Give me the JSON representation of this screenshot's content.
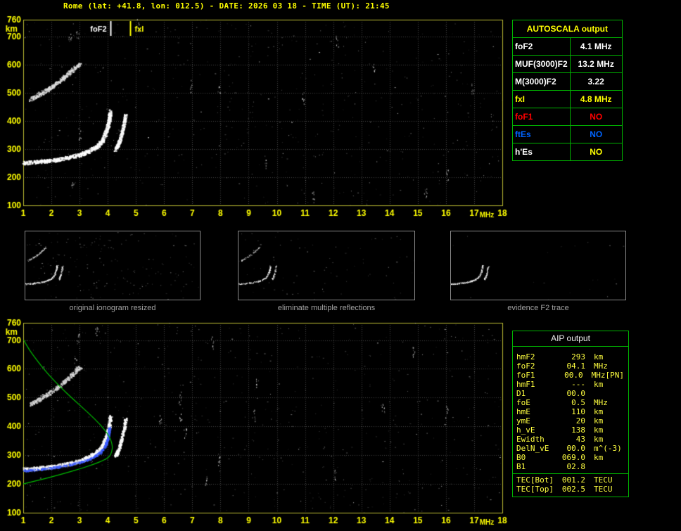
{
  "title": "Rome (lat: +41.8, lon: 012.5) - DATE: 2026 03 18 - TIME (UT): 21:45",
  "colors": {
    "accent_yellow": "#ffff00",
    "table_green": "#00b400",
    "profile_green": "#00bb00",
    "trace_white": "#ffffff",
    "restored_blue": "#3c5cff",
    "no_red": "#ff0000",
    "no_blue": "#0064ff",
    "caption_gray": "#a2a2a2"
  },
  "autoscala_table": {
    "header": "AUTOSCALA output",
    "header_color": "#ffff00",
    "rows": [
      {
        "label": "foF2",
        "value": "4.1 MHz",
        "label_color": "#ffffff",
        "value_color": "#ffffff"
      },
      {
        "label": "MUF(3000)F2",
        "value": "13.2 MHz",
        "label_color": "#ffffff",
        "value_color": "#ffffff"
      },
      {
        "label": "M(3000)F2",
        "value": "3.22",
        "label_color": "#ffffff",
        "value_color": "#ffffff"
      },
      {
        "label": "fxI",
        "value": "4.8 MHz",
        "label_color": "#ffff00",
        "value_color": "#ffff00"
      },
      {
        "label": "foF1",
        "value": "NO",
        "label_color": "#ff0000",
        "value_color": "#ff0000"
      },
      {
        "label": "ftEs",
        "value": "NO",
        "label_color": "#0064ff",
        "value_color": "#0064ff"
      },
      {
        "label": "h'Es",
        "value": "NO",
        "label_color": "#ffffff",
        "value_color": "#ffff00"
      }
    ]
  },
  "thumbnails": [
    {
      "caption": "original ionogram resized",
      "noise": 170,
      "trace_indices": [
        0,
        1,
        2
      ],
      "density_scale": 0.3
    },
    {
      "caption": "eliminate multiple reflections",
      "noise": 75,
      "trace_indices": [
        0,
        1,
        2
      ],
      "density_scale": 0.22
    },
    {
      "caption": "evidence F2 trace",
      "noise": 20,
      "trace_indices": [
        0,
        1
      ],
      "density_scale": 0.28
    }
  ],
  "aip_table": {
    "header": "AIP output",
    "rows": [
      {
        "label": "hmF2",
        "value": "293",
        "unit": "km",
        "extra": ""
      },
      {
        "label": "foF2",
        "value": "04.1",
        "unit": "MHz",
        "extra": ""
      },
      {
        "label": "foF1",
        "value": "00.0",
        "unit": "MHz",
        "extra": "[PN]"
      },
      {
        "label": "hmF1",
        "value": "---",
        "unit": "km",
        "extra": ""
      },
      {
        "label": "D1",
        "value": "00.0",
        "unit": "",
        "extra": ""
      },
      {
        "label": "foE",
        "value": "0.5",
        "unit": "MHz",
        "extra": ""
      },
      {
        "label": "hmE",
        "value": "110",
        "unit": "km",
        "extra": ""
      },
      {
        "label": "ymE",
        "value": "20",
        "unit": "km",
        "extra": ""
      },
      {
        "label": "h_vE",
        "value": "138",
        "unit": "km",
        "extra": ""
      },
      {
        "label": "Ewidth",
        "value": "43",
        "unit": "km",
        "extra": ""
      },
      {
        "label": "DelN_vE",
        "value": "00.0",
        "unit": "m^(-3)",
        "extra": ""
      },
      {
        "label": "B0",
        "value": "069.0",
        "unit": "km",
        "extra": ""
      },
      {
        "label": "B1",
        "value": "02.8",
        "unit": "",
        "extra": ""
      }
    ],
    "tec_rows": [
      {
        "label": "TEC[Bot]",
        "value": "001.2",
        "unit": "TECU"
      },
      {
        "label": "TEC[Top]",
        "value": "002.5",
        "unit": "TECU"
      }
    ]
  },
  "chart_data": [
    {
      "id": "main-ionogram",
      "type": "scatter",
      "title": "recorded ionogram",
      "xlabel": "MHz",
      "ylabel": "km",
      "xlim": [
        1,
        18
      ],
      "ylim": [
        100,
        760
      ],
      "x_ticks": [
        1,
        2,
        3,
        4,
        5,
        6,
        7,
        8,
        9,
        10,
        11,
        12,
        13,
        14,
        15,
        16,
        17,
        18
      ],
      "y_ticks": [
        760,
        700,
        600,
        500,
        400,
        300,
        200,
        100
      ],
      "tick_color": "#ffff00",
      "border_color": "#b8b832",
      "grid": true,
      "legend": "none",
      "noise_points": 520,
      "markers": [
        {
          "label": "foF2",
          "x": 4.1,
          "color": "#ffffff",
          "label_side": "left"
        },
        {
          "label": "fxI",
          "x": 4.8,
          "color": "#ffff00",
          "label_side": "right"
        }
      ],
      "traces": [
        {
          "name": "F2-ordinary-trace",
          "color": "#ffffff",
          "density": 900,
          "spread": 5,
          "points": [
            [
              1.0,
              252
            ],
            [
              1.4,
              255
            ],
            [
              1.8,
              259
            ],
            [
              2.2,
              264
            ],
            [
              2.6,
              271
            ],
            [
              3.0,
              281
            ],
            [
              3.3,
              293
            ],
            [
              3.6,
              310
            ],
            [
              3.8,
              333
            ],
            [
              3.95,
              368
            ],
            [
              4.03,
              400
            ],
            [
              4.08,
              436
            ]
          ]
        },
        {
          "name": "F2-extraordinary-trace",
          "color": "#ffffff",
          "density": 280,
          "spread": 4,
          "points": [
            [
              4.25,
              298
            ],
            [
              4.35,
              316
            ],
            [
              4.45,
              344
            ],
            [
              4.55,
              384
            ],
            [
              4.62,
              428
            ]
          ]
        },
        {
          "name": "second-hop-trace",
          "color": "#e0e0e0",
          "density": 340,
          "spread": 5,
          "points": [
            [
              1.25,
              478
            ],
            [
              1.55,
              496
            ],
            [
              1.85,
              513
            ],
            [
              2.15,
              533
            ],
            [
              2.45,
              557
            ],
            [
              2.75,
              583
            ],
            [
              3.0,
              608
            ]
          ]
        }
      ]
    },
    {
      "id": "profile-ionogram",
      "type": "scatter",
      "title": "ionogram with restored trace and electron density profile",
      "xlabel": "MHz",
      "ylabel": "km",
      "xlim": [
        1,
        18
      ],
      "ylim": [
        100,
        760
      ],
      "x_ticks": [
        1,
        2,
        3,
        4,
        5,
        6,
        7,
        8,
        9,
        10,
        11,
        12,
        13,
        14,
        15,
        16,
        17,
        18
      ],
      "y_ticks": [
        760,
        700,
        600,
        500,
        400,
        300,
        200,
        100
      ],
      "tick_color": "#ffff00",
      "border_color": "#b8b832",
      "grid": true,
      "legend": "none",
      "noise_points": 540,
      "markers": [],
      "traces": [
        {
          "name": "F2-ordinary-trace",
          "color": "#ffffff",
          "density": 820,
          "spread": 5,
          "points": [
            [
              1.0,
              252
            ],
            [
              1.4,
              255
            ],
            [
              1.8,
              259
            ],
            [
              2.2,
              264
            ],
            [
              2.6,
              271
            ],
            [
              3.0,
              281
            ],
            [
              3.3,
              293
            ],
            [
              3.6,
              310
            ],
            [
              3.8,
              333
            ],
            [
              3.95,
              368
            ],
            [
              4.03,
              400
            ],
            [
              4.08,
              436
            ]
          ]
        },
        {
          "name": "F2-extraordinary-trace",
          "color": "#ffffff",
          "density": 260,
          "spread": 4,
          "points": [
            [
              4.25,
              298
            ],
            [
              4.35,
              316
            ],
            [
              4.45,
              344
            ],
            [
              4.55,
              384
            ],
            [
              4.62,
              428
            ]
          ]
        },
        {
          "name": "second-hop-trace",
          "color": "#d8d8d8",
          "density": 300,
          "spread": 5,
          "points": [
            [
              1.25,
              478
            ],
            [
              1.55,
              496
            ],
            [
              1.85,
              513
            ],
            [
              2.15,
              533
            ],
            [
              2.45,
              557
            ],
            [
              2.75,
              583
            ],
            [
              3.0,
              608
            ]
          ]
        }
      ],
      "restored_trace": {
        "name": "autoscala-restored-trace",
        "color": "#3c5cff",
        "density": 400,
        "spread": 3,
        "points": [
          [
            1.0,
            247
          ],
          [
            1.5,
            251
          ],
          [
            2.0,
            257
          ],
          [
            2.5,
            265
          ],
          [
            3.0,
            276
          ],
          [
            3.4,
            290
          ],
          [
            3.7,
            308
          ],
          [
            3.9,
            333
          ],
          [
            4.0,
            362
          ],
          [
            4.05,
            398
          ]
        ]
      },
      "profile": {
        "name": "electron-density-profile",
        "color": "#00bb00",
        "points": [
          [
            1.0,
            200
          ],
          [
            1.6,
            214
          ],
          [
            2.3,
            232
          ],
          [
            3.0,
            252
          ],
          [
            3.5,
            268
          ],
          [
            3.85,
            282
          ],
          [
            4.05,
            293
          ],
          [
            4.15,
            312
          ],
          [
            4.17,
            335
          ],
          [
            4.05,
            368
          ],
          [
            3.75,
            405
          ],
          [
            3.3,
            448
          ],
          [
            2.8,
            492
          ],
          [
            2.3,
            538
          ],
          [
            1.85,
            585
          ],
          [
            1.5,
            628
          ],
          [
            1.2,
            668
          ],
          [
            1.02,
            700
          ]
        ]
      }
    }
  ]
}
